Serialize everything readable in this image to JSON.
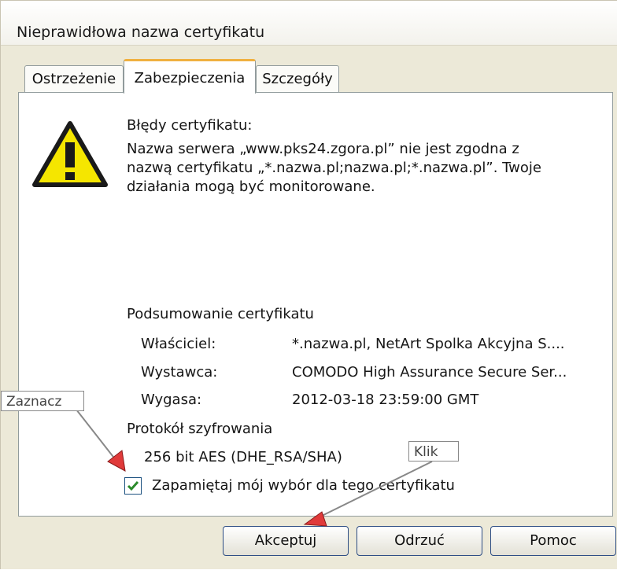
{
  "window": {
    "title": "Nieprawidłowa nazwa certyfikatu"
  },
  "tabs": [
    {
      "label": "Ostrzeżenie",
      "active": false
    },
    {
      "label": "Zabezpieczenia",
      "active": true
    },
    {
      "label": "Szczegóły",
      "active": false
    }
  ],
  "errors": {
    "heading": "Błędy certyfikatu:",
    "lines": [
      "Nazwa serwera „www.pks24.zgora.pl” nie jest zgodna z",
      "nazwą certyfikatu „*.nazwa.pl;nazwa.pl;*.nazwa.pl”. Twoje",
      "działania mogą być monitorowane."
    ]
  },
  "summary": {
    "heading": "Podsumowanie certyfikatu",
    "rows": [
      {
        "label": "Właściciel:",
        "value": "*.nazwa.pl, NetArt Spolka Akcyjna S...."
      },
      {
        "label": "Wystawca:",
        "value": "COMODO High Assurance Secure Ser..."
      },
      {
        "label": "Wygasa:",
        "value": "2012-03-18 23:59:00 GMT"
      }
    ]
  },
  "protocol": {
    "heading": "Protokół szyfrowania",
    "value": "256 bit AES (DHE_RSA/SHA)"
  },
  "remember": {
    "label": "Zapamiętaj mój wybór dla tego certyfikatu",
    "checked": true
  },
  "buttons": {
    "accept": "Akceptuj",
    "reject": "Odrzuć",
    "help": "Pomoc"
  },
  "annotations": {
    "check_hint": "Zaznacz",
    "click_hint": "Klik"
  },
  "colors": {
    "warning_yellow": "#f5e600",
    "annotation_arrow": "#e03a3a",
    "check_green": "#2a8a2a"
  },
  "icons": {
    "warning": "warning-triangle-icon",
    "check": "checkmark-icon"
  }
}
